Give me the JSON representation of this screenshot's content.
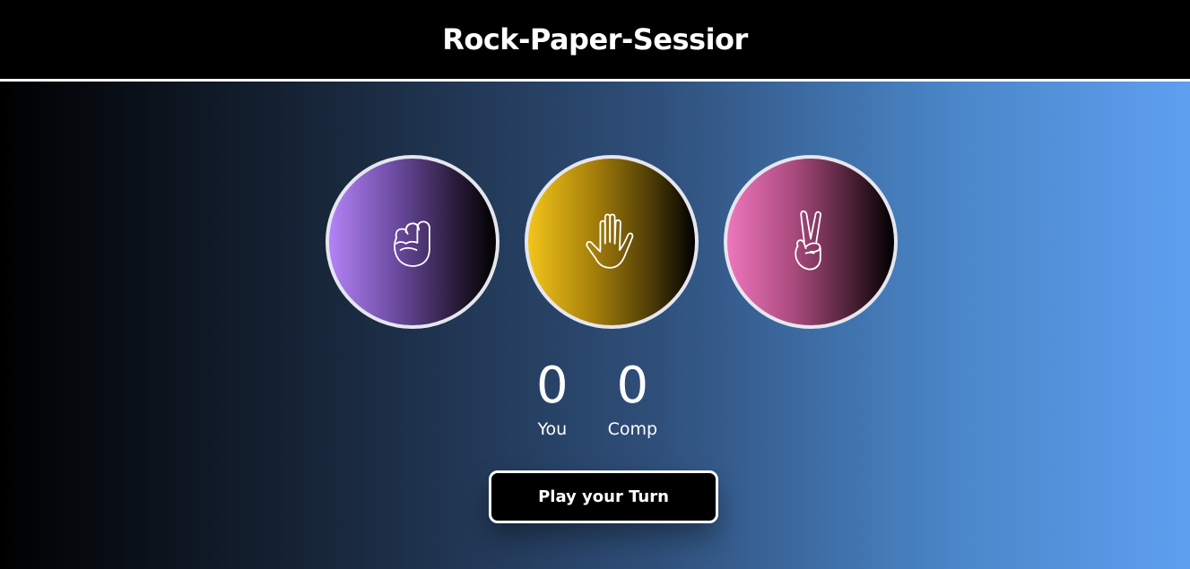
{
  "header": {
    "title": "Rock-Paper-Sessior"
  },
  "choices": [
    {
      "name": "rock",
      "icon": "fist-icon"
    },
    {
      "name": "paper",
      "icon": "open-hand-icon"
    },
    {
      "name": "scissors",
      "icon": "peace-hand-icon"
    }
  ],
  "score": {
    "you_value": "0",
    "you_label": "You",
    "comp_value": "0",
    "comp_label": "Comp"
  },
  "play_button": {
    "label": "Play your Turn"
  },
  "colors": {
    "rock": "#b283f5",
    "paper": "#f2c51a",
    "scissors": "#ee76bd",
    "header_bg": "#000000"
  }
}
